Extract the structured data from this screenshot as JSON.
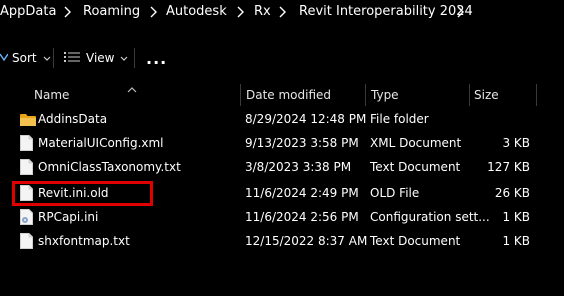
{
  "breadcrumb": {
    "segments": [
      "AppData",
      "Roaming",
      "Autodesk",
      "Rx",
      "Revit Interoperability 2024"
    ]
  },
  "toolbar": {
    "sort_label": "Sort",
    "view_label": "View",
    "more_label": "..."
  },
  "columns": {
    "name": "Name",
    "date": "Date modified",
    "type": "Type",
    "size": "Size"
  },
  "files": [
    {
      "icon": "folder-icon",
      "name": "AddinsData",
      "date": "8/29/2024 12:48 PM",
      "type": "File folder",
      "size": ""
    },
    {
      "icon": "file-icon",
      "name": "MaterialUIConfig.xml",
      "date": "9/13/2023 3:58 PM",
      "type": "XML Document",
      "size": "3 KB"
    },
    {
      "icon": "file-icon",
      "name": "OmniClassTaxonomy.txt",
      "date": "3/8/2023 3:38 PM",
      "type": "Text Document",
      "size": "127 KB"
    },
    {
      "icon": "file-icon",
      "name": "Revit.ini.old",
      "date": "11/6/2024 2:49 PM",
      "type": "OLD File",
      "size": "26 KB"
    },
    {
      "icon": "file-settings-icon",
      "name": "RPCapi.ini",
      "date": "11/6/2024 2:56 PM",
      "type": "Configuration sett...",
      "size": "1 KB"
    },
    {
      "icon": "file-icon",
      "name": "shxfontmap.txt",
      "date": "12/15/2022 8:37 AM",
      "type": "Text Document",
      "size": "1 KB"
    }
  ],
  "colors": {
    "background": "#000000",
    "text": "#ffffff",
    "folder": "#f2c14e",
    "highlight": "#e00000"
  }
}
